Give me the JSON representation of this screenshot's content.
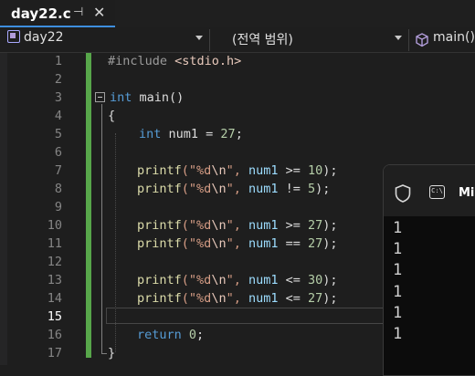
{
  "tab": {
    "title": "day22.c",
    "pin_icon": "pin-icon",
    "close_icon": "close-icon"
  },
  "navbar": {
    "project": "day22",
    "scope": "(전역 범위)",
    "member": "main()"
  },
  "editor": {
    "line_numbers": [
      "1",
      "2",
      "3",
      "4",
      "5",
      "6",
      "7",
      "8",
      "9",
      "10",
      "11",
      "12",
      "13",
      "14",
      "15",
      "16",
      "17"
    ],
    "current_line": 15,
    "code": {
      "l1_directive": "#include ",
      "l1_header": "<stdio.h>",
      "l3_type": "int",
      "l3_name": " main()",
      "l4": "{",
      "l5_type": "int",
      "l5_rest": " num1 = ",
      "l5_num": "27",
      "l5_end": ";",
      "printf": "printf",
      "fmt_open": "(\"",
      "fmt_body": "%d",
      "fmt_esc": "\\n",
      "fmt_close": "\", ",
      "var": "num1",
      "l7_op": " >= ",
      "l7_num": "10",
      "l8_op": " != ",
      "l8_num": "5",
      "l10_op": " >= ",
      "l10_num": "27",
      "l11_op": " == ",
      "l11_num": "27",
      "l13_op": " <= ",
      "l13_num": "30",
      "l14_op": " <= ",
      "l14_num": "27",
      "stmt_end": ");",
      "l16_kw": "return",
      "l16_num": " 0",
      "l16_end": ";",
      "l17": "}"
    }
  },
  "console": {
    "title": "Mi",
    "output": [
      "1",
      "1",
      "1",
      "1",
      "1",
      "1"
    ]
  },
  "colors": {
    "accent": "#3e8ede",
    "change_bar": "#57a64a",
    "keyword": "#569cd6",
    "string": "#d69d85"
  }
}
